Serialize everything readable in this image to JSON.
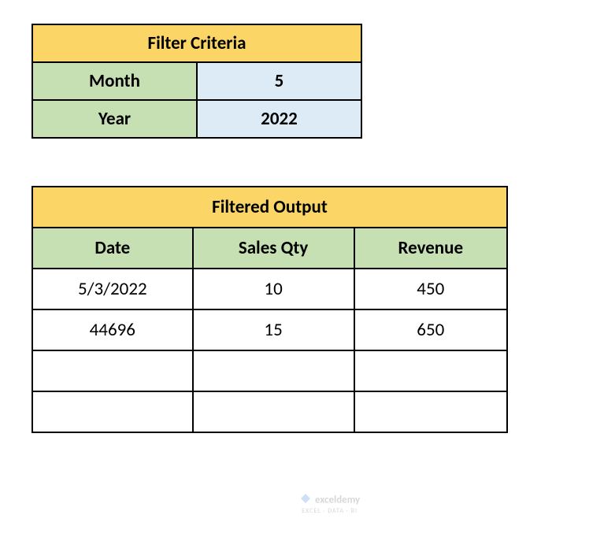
{
  "criteria": {
    "title": "Filter Criteria",
    "rows": [
      {
        "label": "Month",
        "value": "5"
      },
      {
        "label": "Year",
        "value": "2022"
      }
    ]
  },
  "output": {
    "title": "Filtered Output",
    "columns": [
      "Date",
      "Sales Qty",
      "Revenue"
    ],
    "rows": [
      {
        "date": "5/3/2022",
        "qty": "10",
        "revenue": "450"
      },
      {
        "date": "44696",
        "qty": "15",
        "revenue": "650"
      },
      {
        "date": "",
        "qty": "",
        "revenue": ""
      },
      {
        "date": "",
        "qty": "",
        "revenue": ""
      }
    ]
  },
  "watermark": {
    "brand": "exceldemy",
    "tagline": "EXCEL · DATA · BI"
  },
  "chart_data": {
    "type": "table",
    "tables": [
      {
        "title": "Filter Criteria",
        "data": [
          [
            "Month",
            5
          ],
          [
            "Year",
            2022
          ]
        ]
      },
      {
        "title": "Filtered Output",
        "columns": [
          "Date",
          "Sales Qty",
          "Revenue"
        ],
        "data": [
          [
            "5/3/2022",
            10,
            450
          ],
          [
            44696,
            15,
            650
          ]
        ]
      }
    ]
  }
}
